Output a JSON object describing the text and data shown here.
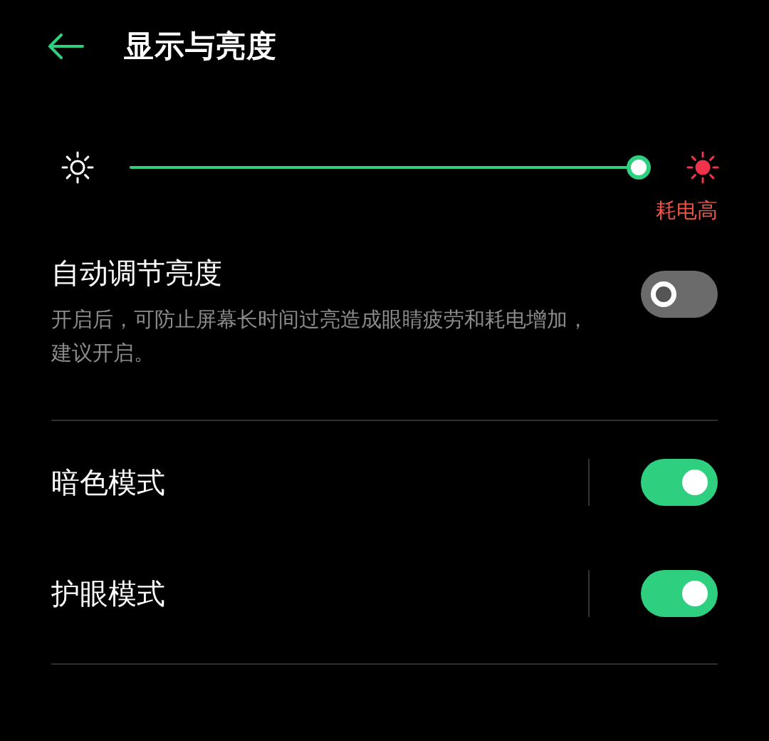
{
  "header": {
    "title": "显示与亮度"
  },
  "brightness": {
    "level": 1,
    "warning": "耗电高"
  },
  "settings": [
    {
      "kind": "described",
      "label": "自动调节亮度",
      "description": "开启后，可防止屏幕长时间过亮造成眼睛疲劳和耗电增加，建议开启。",
      "on": false
    },
    {
      "kind": "split",
      "label": "暗色模式",
      "on": true
    },
    {
      "kind": "split",
      "label": "护眼模式",
      "on": true
    }
  ]
}
